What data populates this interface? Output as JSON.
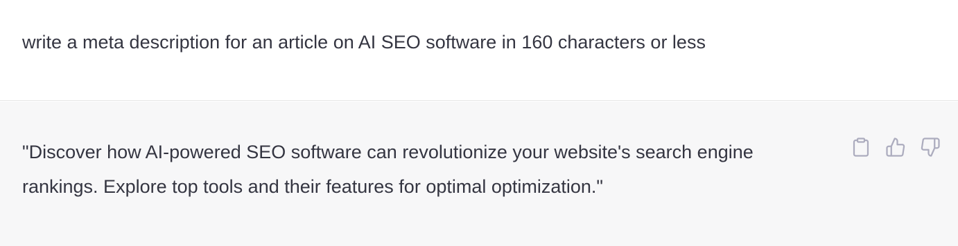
{
  "user_message": {
    "text": "write a meta description for an article on AI SEO software in 160 characters or less"
  },
  "assistant_message": {
    "text": "\"Discover how AI-powered SEO software can revolutionize your website's search engine rankings. Explore top tools and their features for optimal optimization.\"",
    "actions": [
      {
        "icon": "clipboard-icon"
      },
      {
        "icon": "thumbs-up-icon"
      },
      {
        "icon": "thumbs-down-icon"
      }
    ]
  },
  "colors": {
    "text": "#343541",
    "assistant_bg": "#f7f7f8",
    "icon": "#acacbe"
  }
}
